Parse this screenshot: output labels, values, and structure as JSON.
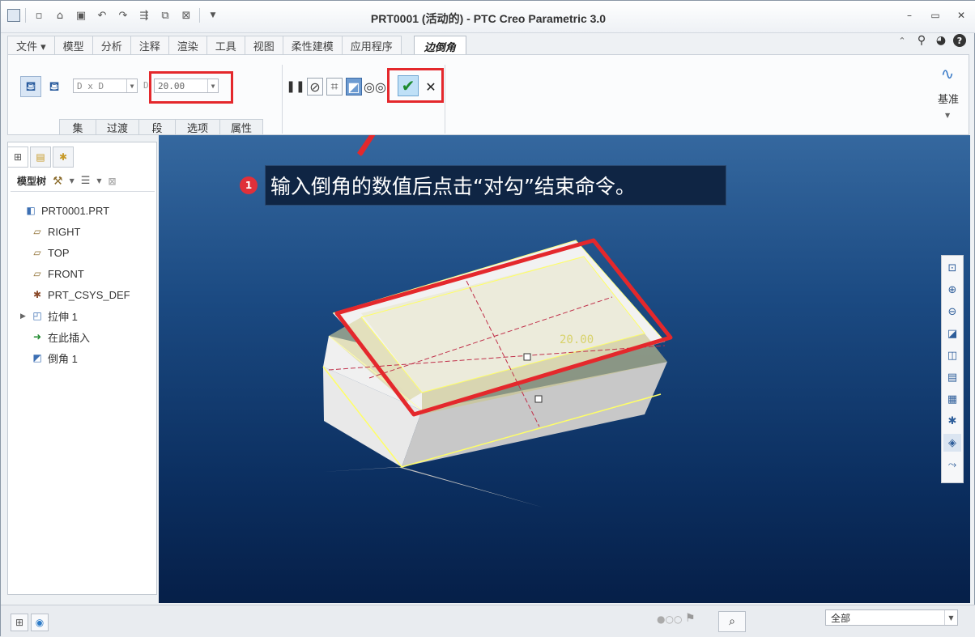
{
  "window": {
    "title": "PRT0001 (活动的) - PTC Creo Parametric 3.0"
  },
  "quick_access": [
    "new-icon",
    "open-icon",
    "save-icon",
    "undo-icon",
    "redo-icon",
    "regenerate-icon",
    "windows-icon",
    "close-icon",
    "customize-icon"
  ],
  "tabs": [
    {
      "label": "文件 ▾"
    },
    {
      "label": "模型"
    },
    {
      "label": "分析"
    },
    {
      "label": "注释"
    },
    {
      "label": "渲染"
    },
    {
      "label": "工具"
    },
    {
      "label": "视图"
    },
    {
      "label": "柔性建模"
    },
    {
      "label": "应用程序"
    }
  ],
  "active_tab": {
    "label": "边倒角"
  },
  "ribbon": {
    "dim_scheme": "D x D",
    "d_label": "D",
    "d_value": "20.00",
    "group_labels": [
      "集",
      "过渡",
      "段",
      "选项",
      "属性"
    ],
    "datum_label": "基准",
    "accent_red": "#e4282c"
  },
  "panel": {
    "toolbar_label": "模型树",
    "tree": [
      {
        "label": "PRT0001.PRT",
        "icon": "part-icon"
      },
      {
        "label": "RIGHT",
        "icon": "datum-plane-icon"
      },
      {
        "label": "TOP",
        "icon": "datum-plane-icon"
      },
      {
        "label": "FRONT",
        "icon": "datum-plane-icon"
      },
      {
        "label": "PRT_CSYS_DEF",
        "icon": "csys-icon"
      },
      {
        "label": "拉伸 1",
        "icon": "extrude-icon"
      },
      {
        "label": "在此插入",
        "icon": "insert-arrow-icon"
      },
      {
        "label": "倒角 1",
        "icon": "chamfer-icon"
      }
    ]
  },
  "viewport": {
    "annotation_number": "1",
    "annotation_text": "输入倒角的数值后点击“对勾”结束命令。",
    "dimension_text": "20.00"
  },
  "status": {
    "filter_value": "全部"
  }
}
